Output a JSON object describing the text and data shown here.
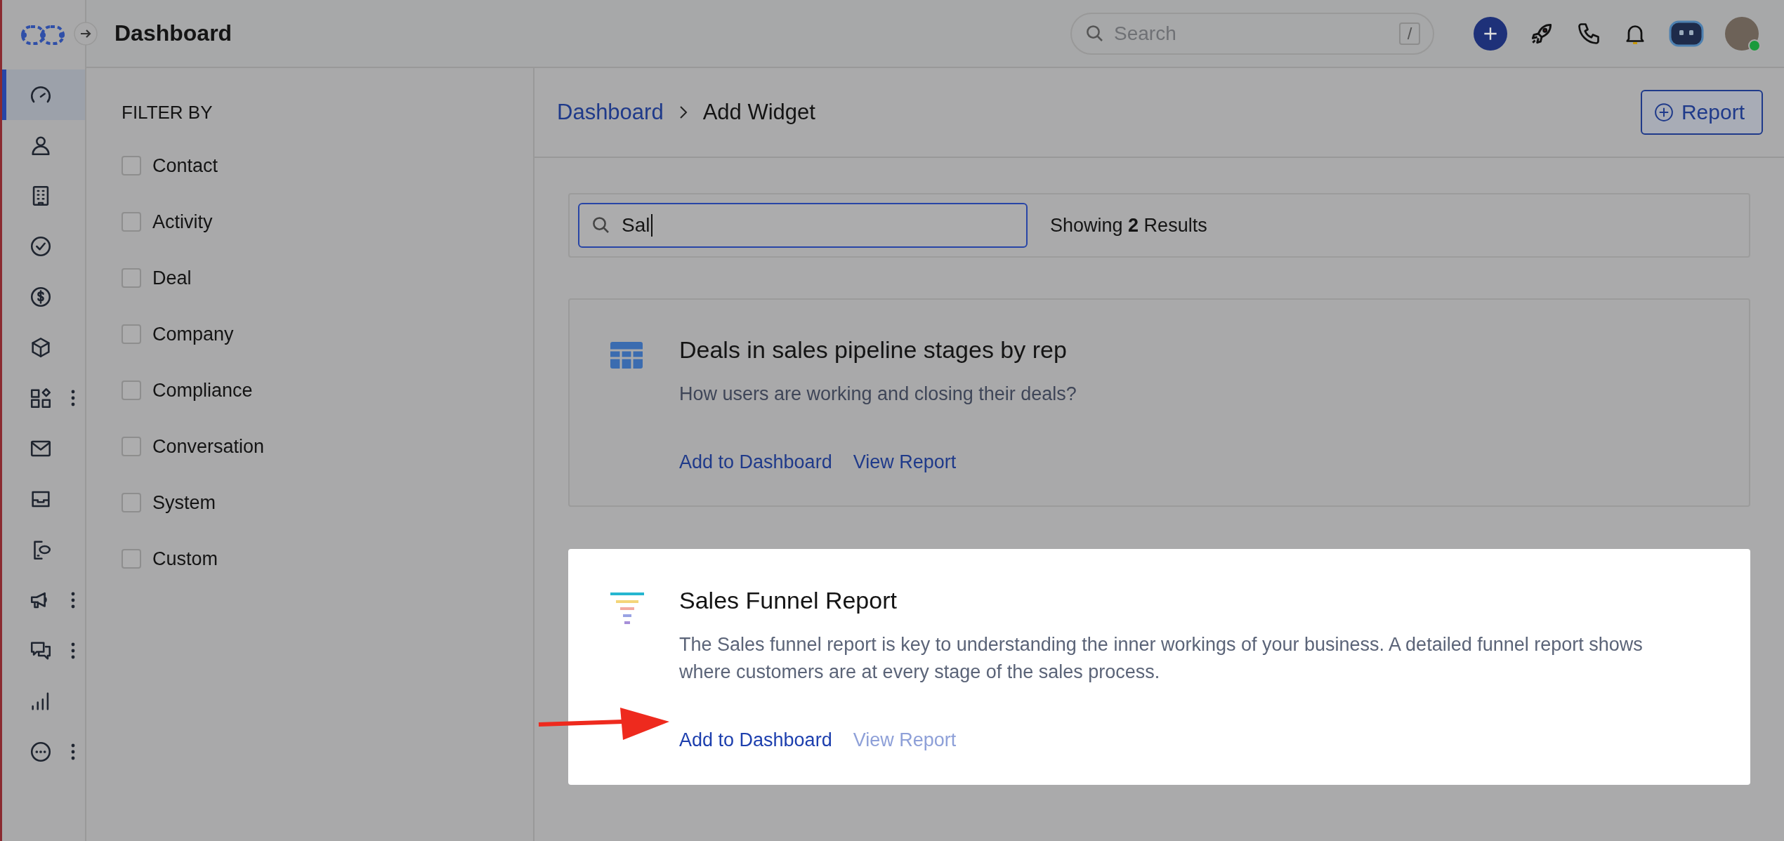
{
  "header": {
    "title": "Dashboard",
    "search_placeholder": "Search",
    "search_shortcut": "/"
  },
  "sidebar": {
    "items": [
      {
        "kind": "gauge",
        "selected": true,
        "has_menu": false
      },
      {
        "kind": "person",
        "selected": false,
        "has_menu": false
      },
      {
        "kind": "building",
        "selected": false,
        "has_menu": false
      },
      {
        "kind": "check",
        "selected": false,
        "has_menu": false
      },
      {
        "kind": "dollar",
        "selected": false,
        "has_menu": false
      },
      {
        "kind": "cube",
        "selected": false,
        "has_menu": false
      },
      {
        "kind": "apps",
        "selected": false,
        "has_menu": true
      },
      {
        "kind": "mail",
        "selected": false,
        "has_menu": false
      },
      {
        "kind": "inbox",
        "selected": false,
        "has_menu": false
      },
      {
        "kind": "phone-chat",
        "selected": false,
        "has_menu": false
      },
      {
        "kind": "megaphone",
        "selected": false,
        "has_menu": true
      },
      {
        "kind": "chat",
        "selected": false,
        "has_menu": true
      },
      {
        "kind": "bars",
        "selected": false,
        "has_menu": false
      },
      {
        "kind": "more",
        "selected": false,
        "has_menu": true
      }
    ]
  },
  "filter": {
    "title": "FILTER BY",
    "options": [
      {
        "label": "Contact",
        "checked": false
      },
      {
        "label": "Activity",
        "checked": false
      },
      {
        "label": "Deal",
        "checked": false
      },
      {
        "label": "Company",
        "checked": false
      },
      {
        "label": "Compliance",
        "checked": false
      },
      {
        "label": "Conversation",
        "checked": false
      },
      {
        "label": "System",
        "checked": false
      },
      {
        "label": "Custom",
        "checked": false
      }
    ]
  },
  "breadcrumb": [
    {
      "label": "Dashboard",
      "link": true
    },
    {
      "label": "Add Widget",
      "link": false
    }
  ],
  "report_button": "Report",
  "widget_search": {
    "value": "Sal",
    "results": "Showing **2** Results"
  },
  "cards": [
    {
      "kind": "table",
      "title": "Deals in sales pipeline stages by rep",
      "description": "How users are working and closing their deals?",
      "highlighted": false,
      "pointer": false,
      "actions": [
        {
          "label": "Add to Dashboard",
          "disabled": false
        },
        {
          "label": "View Report",
          "disabled": false
        }
      ]
    },
    {
      "kind": "funnel",
      "title": "Sales Funnel Report",
      "description": "The Sales funnel report is key to understanding the inner workings of your business. A detailed funnel report shows where customers are at every stage of the sales process.",
      "highlighted": true,
      "pointer": true,
      "actions": [
        {
          "label": "Add to Dashboard",
          "disabled": false
        },
        {
          "label": "View Report",
          "disabled": true
        }
      ]
    }
  ]
}
